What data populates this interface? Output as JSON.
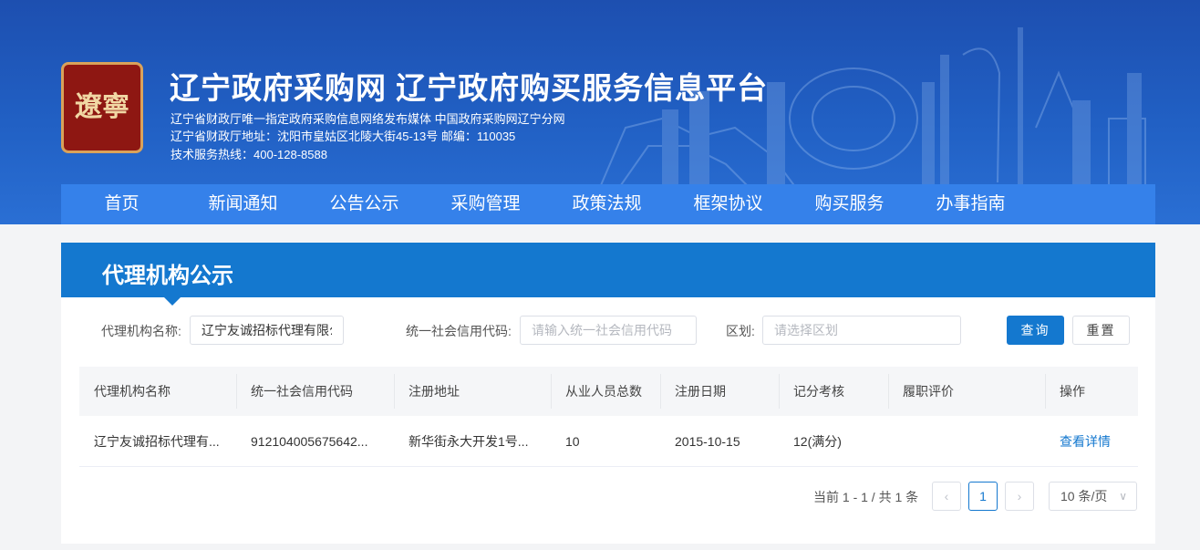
{
  "header": {
    "logo_text": "遼寧",
    "title": "辽宁政府采购网 辽宁政府购买服务信息平台",
    "sub_line1": "辽宁省财政厅唯一指定政府采购信息网络发布媒体 中国政府采购网辽宁分网",
    "sub_line2": "辽宁省财政厅地址：沈阳市皇姑区北陵大街45-13号 邮编：110035",
    "sub_line3": "技术服务热线：400-128-8588"
  },
  "nav": {
    "items": [
      {
        "label": "首页"
      },
      {
        "label": "新闻通知"
      },
      {
        "label": "公告公示"
      },
      {
        "label": "采购管理"
      },
      {
        "label": "政策法规"
      },
      {
        "label": "框架协议"
      },
      {
        "label": "购买服务"
      },
      {
        "label": "办事指南"
      }
    ]
  },
  "panel": {
    "title": "代理机构公示"
  },
  "filters": {
    "name_label": "代理机构名称:",
    "name_value": "辽宁友诚招标代理有限公司",
    "code_label": "统一社会信用代码:",
    "code_placeholder": "请输入统一社会信用代码",
    "region_label": "区划:",
    "region_placeholder": "请选择区划",
    "query_label": "查询",
    "reset_label": "重置"
  },
  "table": {
    "headers": [
      "代理机构名称",
      "统一社会信用代码",
      "注册地址",
      "从业人员总数",
      "注册日期",
      "记分考核",
      "履职评价",
      "操作"
    ],
    "rows": [
      [
        "辽宁友诚招标代理有...",
        "912104005675642...",
        "新华街永大开发1号...",
        "10",
        "2015-10-15",
        "12(满分)",
        "",
        "查看详情"
      ]
    ]
  },
  "pagination": {
    "total_text": "当前 1 - 1 / 共 1 条",
    "prev_label": "‹",
    "page": "1",
    "next_label": "›",
    "page_size": "10 条/页"
  }
}
